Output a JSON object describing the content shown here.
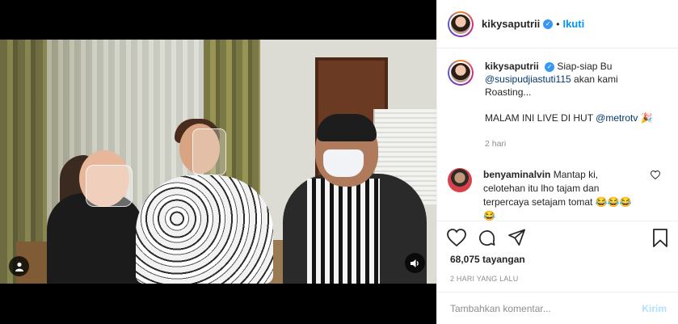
{
  "video": {
    "tagged_user_icon": "user-icon",
    "sound_icon": "speaker-icon"
  },
  "header": {
    "username": "kikysaputrii",
    "verified_icon": "verified-badge-icon",
    "separator": "•",
    "follow_label": "Ikuti"
  },
  "caption": {
    "username": "kikysaputrii",
    "text_1": "Siap-siap Bu",
    "mention": "@susipudjiastuti115",
    "text_2": "akan kami Roasting...",
    "text_3": "MALAM INI LIVE DI HUT",
    "mention_2": "@metrotv",
    "emoji": "🎉",
    "time": "2 hari"
  },
  "comments": [
    {
      "username": "benyaminalvin",
      "text": "Mantap ki, celotehan itu lho tajam dan terpercaya setajam tomat 😂😂😂😂",
      "like_icon": "heart-icon"
    }
  ],
  "actions": {
    "like_icon": "heart-icon",
    "comment_icon": "comment-icon",
    "share_icon": "share-icon",
    "save_icon": "bookmark-icon"
  },
  "views": "68,075 tayangan",
  "date": "2 HARI YANG LALU",
  "add_comment": {
    "placeholder": "Tambahkan komentar...",
    "post_label": "Kirim"
  },
  "colors": {
    "accent": "#0095f6",
    "verified": "#3897f0",
    "post_disabled": "#b2dffc"
  }
}
